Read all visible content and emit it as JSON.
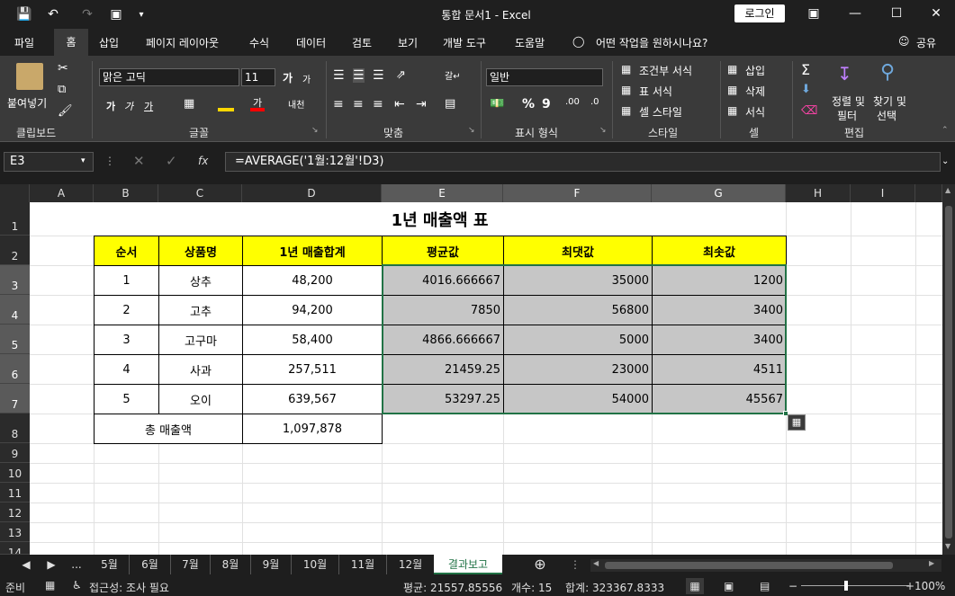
{
  "window": {
    "title": "통합 문서1 - Excel",
    "login": "로그인"
  },
  "menu": [
    "파일",
    "홈",
    "삽입",
    "페이지 레이아웃",
    "수식",
    "데이터",
    "검토",
    "보기",
    "개발 도구",
    "도움말",
    "어떤 작업을 원하시나요?",
    "공유"
  ],
  "ribbon": {
    "clipboard": {
      "paste": "붙여넣기",
      "label": "클립보드"
    },
    "font": {
      "name": "맑은 고딕",
      "size": "11",
      "label": "글꼴",
      "bold": "가",
      "italic": "가",
      "underline": "가"
    },
    "align": {
      "label": "맞춤"
    },
    "number": {
      "format": "일반",
      "label": "표시 형식",
      "percent": "%"
    },
    "styles": {
      "cond": "조건부 서식",
      "table": "표 서식",
      "cell": "셀 스타일",
      "label": "스타일"
    },
    "cells": {
      "insert": "삽입",
      "delete": "삭제",
      "format": "서식",
      "label": "셀"
    },
    "edit": {
      "sort": "정렬 및",
      "filter": "필터",
      "find": "찾기 및",
      "select": "선택",
      "label": "편집"
    }
  },
  "formula": {
    "namebox": "E3",
    "content": "=AVERAGE('1월:12월'!D3)",
    "fx": "fx"
  },
  "columns": [
    "A",
    "B",
    "C",
    "D",
    "E",
    "F",
    "G",
    "H",
    "I"
  ],
  "rows": [
    "1",
    "2",
    "3",
    "4",
    "5",
    "6",
    "7",
    "8",
    "9",
    "10",
    "11",
    "12",
    "13",
    "14"
  ],
  "sheet": {
    "title": "1년 매출액 표",
    "headers": [
      "순서",
      "상품명",
      "1년 매출합계",
      "평균값",
      "최댓값",
      "최솟값"
    ],
    "data": [
      [
        "1",
        "상추",
        "48,200",
        "4016.666667",
        "35000",
        "1200"
      ],
      [
        "2",
        "고추",
        "94,200",
        "7850",
        "56800",
        "3400"
      ],
      [
        "3",
        "고구마",
        "58,400",
        "4866.666667",
        "5000",
        "3400"
      ],
      [
        "4",
        "사과",
        "257,511",
        "21459.25",
        "23000",
        "4511"
      ],
      [
        "5",
        "오이",
        "639,567",
        "53297.25",
        "54000",
        "45567"
      ]
    ],
    "total_label": "총 매출액",
    "total_value": "1,097,878"
  },
  "tabs": [
    "...",
    "5월",
    "6월",
    "7월",
    "8월",
    "9월",
    "10월",
    "11월",
    "12월",
    "결과보고"
  ],
  "status": {
    "ready": "준비",
    "access": "접근성: 조사 필요",
    "avg": "평균: 21557.85556",
    "count": "개수: 15",
    "sum": "합계: 323367.8333",
    "zoom": "100%"
  },
  "colors": {
    "header_fill": "#ffff00",
    "selection_fill": "#c6c6c6",
    "accent": "#217346"
  }
}
